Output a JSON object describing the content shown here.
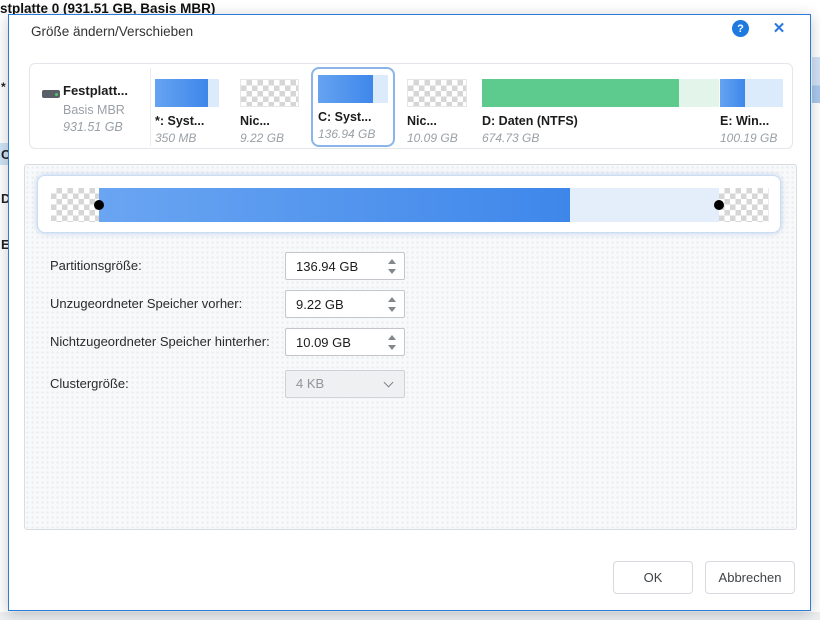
{
  "background": {
    "top_text": "stplatte 0 (931.51 GB, Basis MBR)",
    "left_items": [
      {
        "label": "*"
      },
      {
        "label": "C"
      },
      {
        "label": "D"
      },
      {
        "label": "E"
      }
    ]
  },
  "dialog": {
    "title": "Größe ändern/Verschieben",
    "help_glyph": "?",
    "close_glyph": "✕",
    "disk": {
      "name": "Festplatt...",
      "layout": "Basis MBR",
      "size": "931.51 GB"
    },
    "partitions": [
      {
        "label": "*: Syst...",
        "size": "350 MB",
        "kind": "blue"
      },
      {
        "label": "Nic...",
        "size": "9.22 GB",
        "kind": "unallocated"
      },
      {
        "label": "C: Syst...",
        "size": "136.94 GB",
        "kind": "blue",
        "selected": true
      },
      {
        "label": "Nic...",
        "size": "10.09 GB",
        "kind": "unallocated"
      },
      {
        "label": "D: Daten (NTFS)",
        "size": "674.73 GB",
        "kind": "green"
      },
      {
        "label": "E: Win...",
        "size": "100.19 GB",
        "kind": "blue"
      }
    ],
    "fields": [
      {
        "label": "Partitionsgröße:",
        "value": "136.94 GB",
        "type": "spinner"
      },
      {
        "label": "Unzugeordneter Speicher vorher:",
        "value": "9.22 GB",
        "type": "spinner"
      },
      {
        "label": "Nichtzugeordneter Speicher hinterher:",
        "value": "10.09 GB",
        "type": "spinner"
      },
      {
        "label": "Clustergröße:",
        "value": "4 KB",
        "type": "dropdown",
        "disabled": true
      }
    ],
    "buttons": {
      "ok": "OK",
      "cancel": "Abbrechen"
    },
    "colors": {
      "accent_blue": "#2779dd",
      "partition_blue": "#4a90ea",
      "partition_green": "#5ecb8e",
      "dialog_border": "#2b7cd9",
      "unallocated_checker": "#d6d6d6"
    }
  }
}
